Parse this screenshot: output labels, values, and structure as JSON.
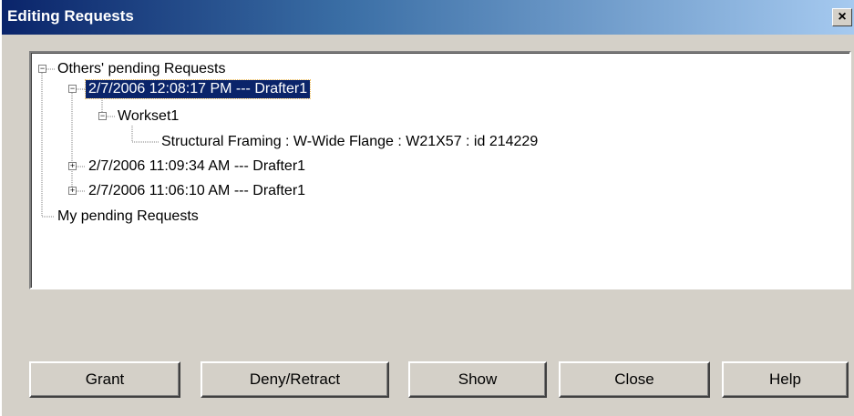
{
  "window": {
    "title": "Editing Requests",
    "close_glyph": "×"
  },
  "tree": {
    "root_others": "Others' pending Requests",
    "request_1": "2/7/2006 12:08:17 PM --- Drafter1",
    "workset_1": "Workset1",
    "element_1": "Structural Framing : W-Wide Flange : W21X57 : id 214229",
    "request_2": "2/7/2006 11:09:34 AM --- Drafter1",
    "request_3": "2/7/2006 11:06:10 AM --- Drafter1",
    "root_mine": "My pending Requests",
    "expanded_glyph": "−",
    "collapsed_glyph": "+"
  },
  "buttons": {
    "grant": "Grant",
    "deny": "Deny/Retract",
    "show": "Show",
    "close": "Close",
    "help": "Help"
  },
  "colors": {
    "selection": "#0a246a",
    "titlebar": "#0a246a",
    "face": "#d4d0c8"
  }
}
